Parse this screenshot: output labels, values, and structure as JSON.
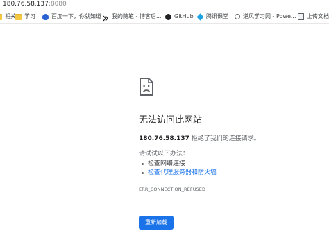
{
  "addressbar": {
    "host": "180.76.58.137",
    "port": ":8080"
  },
  "bookmarks": [
    {
      "label": "相关",
      "icon": "folder-icon"
    },
    {
      "label": "学习",
      "icon": "folder-icon"
    },
    {
      "label": "百度一下，你就知道",
      "icon": "baidu-icon"
    },
    {
      "label": "我的随笔 - 博客后...",
      "icon": "cnblogs-icon"
    },
    {
      "label": "GitHub",
      "icon": "github-icon"
    },
    {
      "label": "腾讯课堂",
      "icon": "tencent-class-icon"
    },
    {
      "label": "逆风学习网 - Powe...",
      "icon": "globe-icon"
    },
    {
      "label": "上传文档",
      "icon": "document-icon"
    }
  ],
  "error": {
    "title": "无法访问此网站",
    "host": "180.76.58.137",
    "message": " 拒绝了我们的连接请求。",
    "try_label": "请试试以下办法：",
    "suggestions": [
      "检查网络连接",
      "检查代理服务器和防火墙"
    ],
    "code": "ERR_CONNECTION_REFUSED",
    "reload_label": "重新加载"
  },
  "colors": {
    "accent": "#1a73e8",
    "text": "#202124",
    "muted": "#5f6368"
  }
}
